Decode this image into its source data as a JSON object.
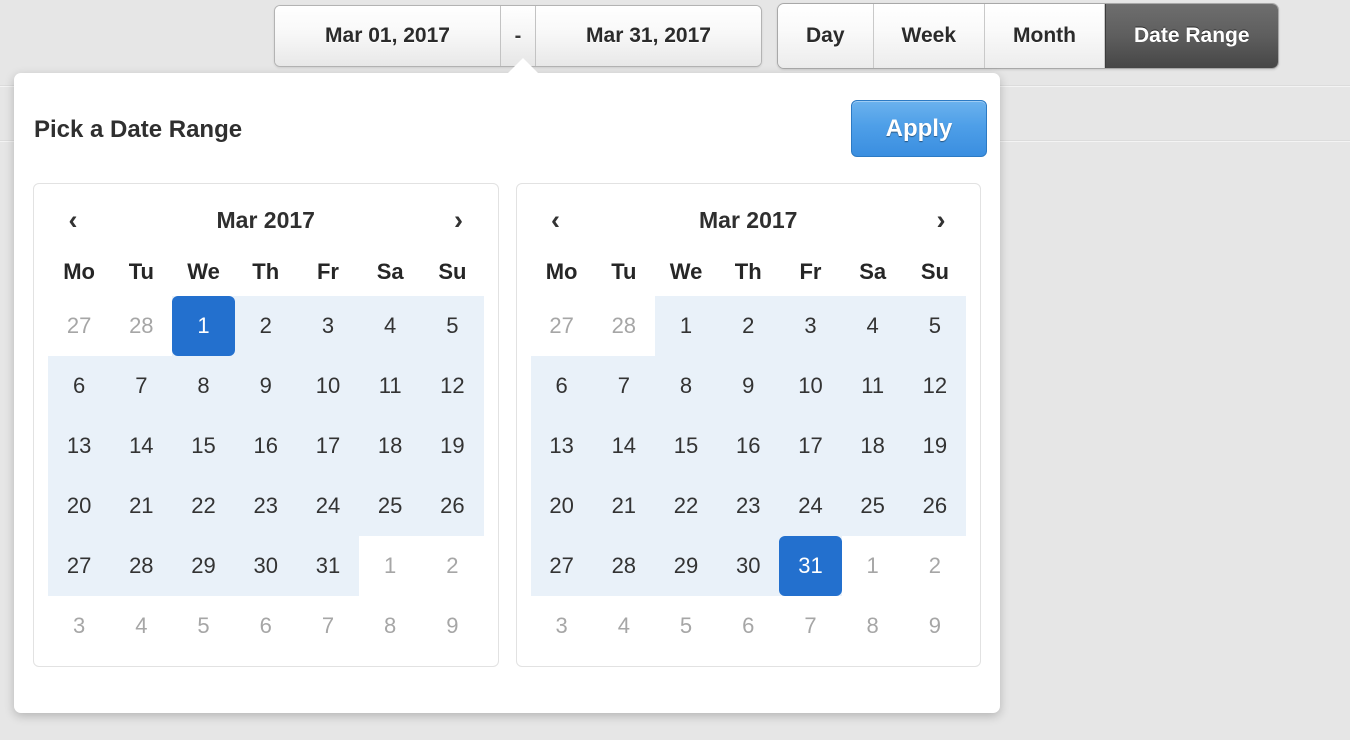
{
  "toolbar": {
    "date_start": "Mar 01, 2017",
    "date_separator": "-",
    "date_end": "Mar 31, 2017",
    "views": [
      {
        "label": "Day",
        "active": false
      },
      {
        "label": "Week",
        "active": false
      },
      {
        "label": "Month",
        "active": false
      },
      {
        "label": "Date Range",
        "active": true
      }
    ]
  },
  "popover": {
    "title": "Pick a Date Range",
    "apply_label": "Apply",
    "calendars": [
      {
        "title": "Mar 2017",
        "prev_icon": "‹",
        "next_icon": "›",
        "dow": [
          "Mo",
          "Tu",
          "We",
          "Th",
          "Fr",
          "Sa",
          "Su"
        ],
        "weeks": [
          [
            {
              "d": "27",
              "state": "muted"
            },
            {
              "d": "28",
              "state": "muted"
            },
            {
              "d": "1",
              "state": "selected"
            },
            {
              "d": "2",
              "state": "in-range"
            },
            {
              "d": "3",
              "state": "in-range"
            },
            {
              "d": "4",
              "state": "in-range"
            },
            {
              "d": "5",
              "state": "in-range"
            }
          ],
          [
            {
              "d": "6",
              "state": "in-range"
            },
            {
              "d": "7",
              "state": "in-range"
            },
            {
              "d": "8",
              "state": "in-range"
            },
            {
              "d": "9",
              "state": "in-range"
            },
            {
              "d": "10",
              "state": "in-range"
            },
            {
              "d": "11",
              "state": "in-range"
            },
            {
              "d": "12",
              "state": "in-range"
            }
          ],
          [
            {
              "d": "13",
              "state": "in-range"
            },
            {
              "d": "14",
              "state": "in-range"
            },
            {
              "d": "15",
              "state": "in-range"
            },
            {
              "d": "16",
              "state": "in-range"
            },
            {
              "d": "17",
              "state": "in-range"
            },
            {
              "d": "18",
              "state": "in-range"
            },
            {
              "d": "19",
              "state": "in-range"
            }
          ],
          [
            {
              "d": "20",
              "state": "in-range"
            },
            {
              "d": "21",
              "state": "in-range"
            },
            {
              "d": "22",
              "state": "in-range"
            },
            {
              "d": "23",
              "state": "in-range"
            },
            {
              "d": "24",
              "state": "in-range"
            },
            {
              "d": "25",
              "state": "in-range"
            },
            {
              "d": "26",
              "state": "in-range"
            }
          ],
          [
            {
              "d": "27",
              "state": "in-range"
            },
            {
              "d": "28",
              "state": "in-range"
            },
            {
              "d": "29",
              "state": "in-range"
            },
            {
              "d": "30",
              "state": "in-range"
            },
            {
              "d": "31",
              "state": "in-range"
            },
            {
              "d": "1",
              "state": "muted"
            },
            {
              "d": "2",
              "state": "muted"
            }
          ],
          [
            {
              "d": "3",
              "state": "muted"
            },
            {
              "d": "4",
              "state": "muted"
            },
            {
              "d": "5",
              "state": "muted"
            },
            {
              "d": "6",
              "state": "muted"
            },
            {
              "d": "7",
              "state": "muted"
            },
            {
              "d": "8",
              "state": "muted"
            },
            {
              "d": "9",
              "state": "muted"
            }
          ]
        ]
      },
      {
        "title": "Mar 2017",
        "prev_icon": "‹",
        "next_icon": "›",
        "dow": [
          "Mo",
          "Tu",
          "We",
          "Th",
          "Fr",
          "Sa",
          "Su"
        ],
        "weeks": [
          [
            {
              "d": "27",
              "state": "muted"
            },
            {
              "d": "28",
              "state": "muted"
            },
            {
              "d": "1",
              "state": "in-range"
            },
            {
              "d": "2",
              "state": "in-range"
            },
            {
              "d": "3",
              "state": "in-range"
            },
            {
              "d": "4",
              "state": "in-range"
            },
            {
              "d": "5",
              "state": "in-range"
            }
          ],
          [
            {
              "d": "6",
              "state": "in-range"
            },
            {
              "d": "7",
              "state": "in-range"
            },
            {
              "d": "8",
              "state": "in-range"
            },
            {
              "d": "9",
              "state": "in-range"
            },
            {
              "d": "10",
              "state": "in-range"
            },
            {
              "d": "11",
              "state": "in-range"
            },
            {
              "d": "12",
              "state": "in-range"
            }
          ],
          [
            {
              "d": "13",
              "state": "in-range"
            },
            {
              "d": "14",
              "state": "in-range"
            },
            {
              "d": "15",
              "state": "in-range"
            },
            {
              "d": "16",
              "state": "in-range"
            },
            {
              "d": "17",
              "state": "in-range"
            },
            {
              "d": "18",
              "state": "in-range"
            },
            {
              "d": "19",
              "state": "in-range"
            }
          ],
          [
            {
              "d": "20",
              "state": "in-range"
            },
            {
              "d": "21",
              "state": "in-range"
            },
            {
              "d": "22",
              "state": "in-range"
            },
            {
              "d": "23",
              "state": "in-range"
            },
            {
              "d": "24",
              "state": "in-range"
            },
            {
              "d": "25",
              "state": "in-range"
            },
            {
              "d": "26",
              "state": "in-range"
            }
          ],
          [
            {
              "d": "27",
              "state": "in-range"
            },
            {
              "d": "28",
              "state": "in-range"
            },
            {
              "d": "29",
              "state": "in-range"
            },
            {
              "d": "30",
              "state": "in-range"
            },
            {
              "d": "31",
              "state": "selected"
            },
            {
              "d": "1",
              "state": "muted"
            },
            {
              "d": "2",
              "state": "muted"
            }
          ],
          [
            {
              "d": "3",
              "state": "muted"
            },
            {
              "d": "4",
              "state": "muted"
            },
            {
              "d": "5",
              "state": "muted"
            },
            {
              "d": "6",
              "state": "muted"
            },
            {
              "d": "7",
              "state": "muted"
            },
            {
              "d": "8",
              "state": "muted"
            },
            {
              "d": "9",
              "state": "muted"
            }
          ]
        ]
      }
    ]
  },
  "colors": {
    "selected_day": "#2370ce",
    "range_highlight": "#e9f1f9",
    "apply_button": "#4e9fe8",
    "active_tab": "#5e5e5e",
    "page_background": "#e6e6e6"
  }
}
